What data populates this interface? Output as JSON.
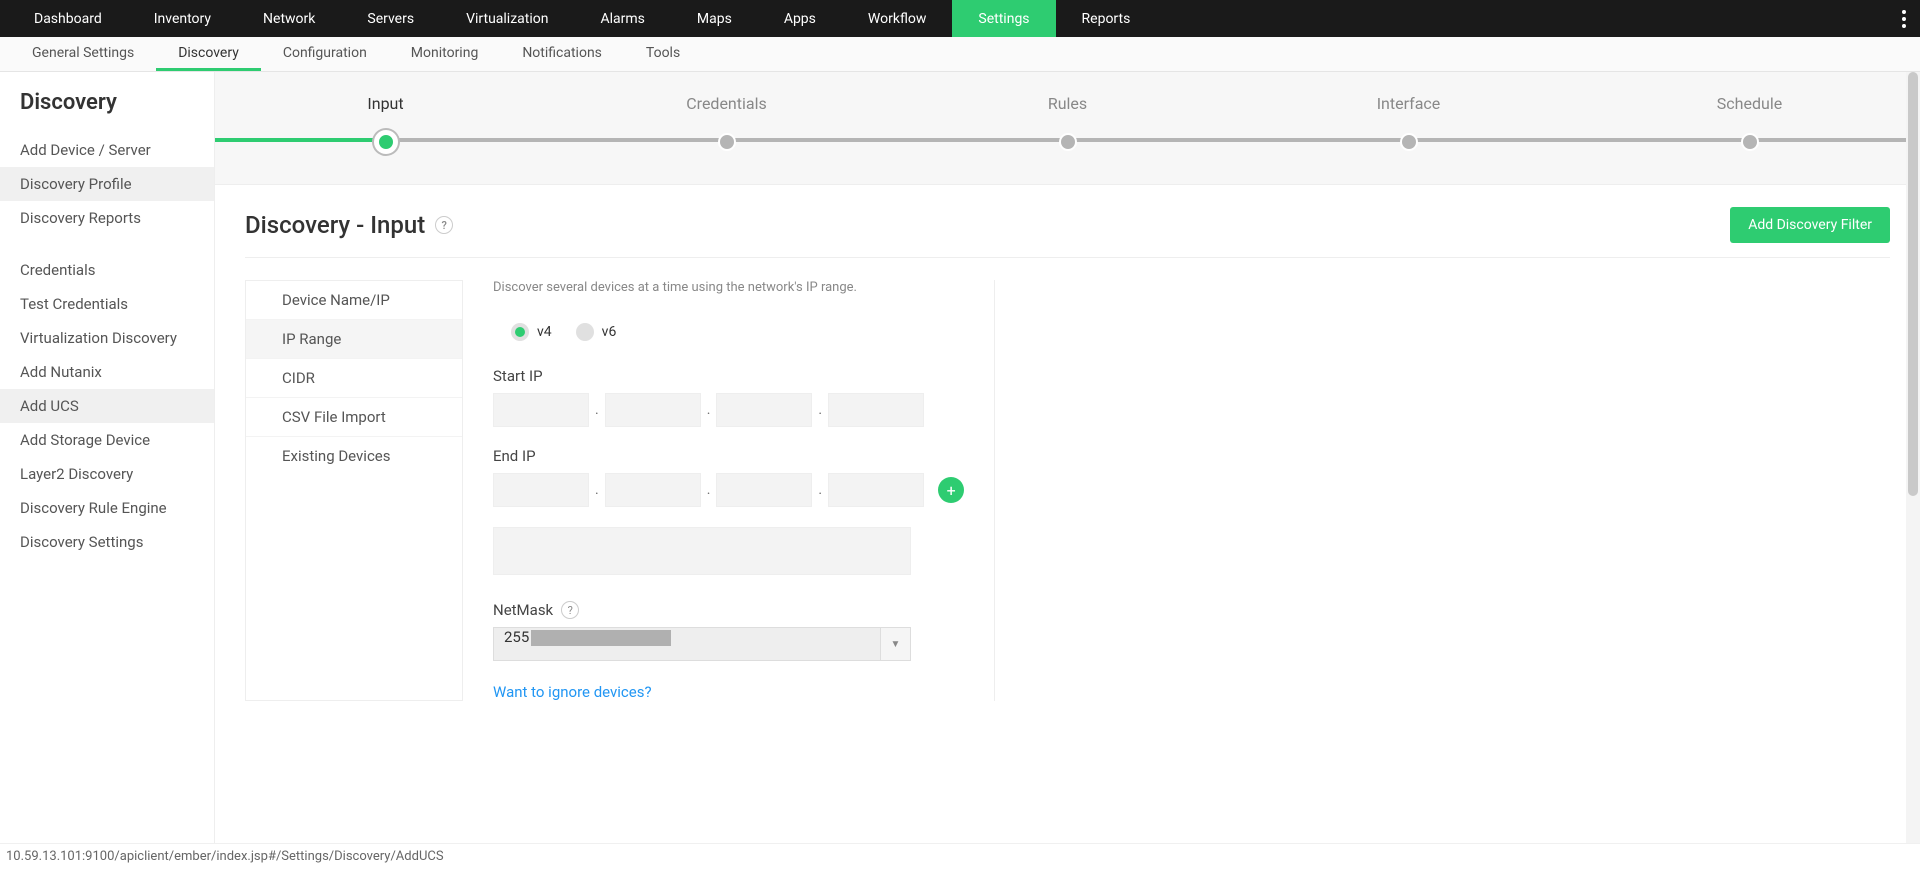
{
  "topnav": {
    "items": [
      "Dashboard",
      "Inventory",
      "Network",
      "Servers",
      "Virtualization",
      "Alarms",
      "Maps",
      "Apps",
      "Workflow",
      "Settings",
      "Reports"
    ],
    "active": "Settings"
  },
  "subnav": {
    "items": [
      "General Settings",
      "Discovery",
      "Configuration",
      "Monitoring",
      "Notifications",
      "Tools"
    ],
    "active": "Discovery"
  },
  "sidebar": {
    "title": "Discovery",
    "group1": [
      "Add Device / Server",
      "Discovery Profile",
      "Discovery Reports"
    ],
    "group1_active": "Discovery Profile",
    "group2": [
      "Credentials",
      "Test Credentials",
      "Virtualization Discovery",
      "Add Nutanix",
      "Add UCS",
      "Add Storage Device",
      "Layer2 Discovery",
      "Discovery Rule Engine",
      "Discovery Settings"
    ],
    "group2_active": "Add UCS"
  },
  "stepper": {
    "steps": [
      "Input",
      "Credentials",
      "Rules",
      "Interface",
      "Schedule"
    ],
    "active": "Input"
  },
  "page": {
    "title": "Discovery - Input",
    "help": "?",
    "primary_button": "Add Discovery Filter"
  },
  "methods": {
    "items": [
      "Device Name/IP",
      "IP Range",
      "CIDR",
      "CSV File Import",
      "Existing Devices"
    ],
    "active": "IP Range"
  },
  "form": {
    "hint": "Discover several devices at a time using the network's IP range.",
    "ipver": {
      "v4": "v4",
      "v6": "v6",
      "selected": "v4"
    },
    "start_ip_label": "Start IP",
    "end_ip_label": "End IP",
    "netmask_label": "NetMask",
    "netmask_value": "255",
    "ignore_link": "Want to ignore devices?"
  },
  "statusbar": {
    "text": "10.59.13.101:9100/apiclient/ember/index.jsp#/Settings/Discovery/AddUCS"
  }
}
